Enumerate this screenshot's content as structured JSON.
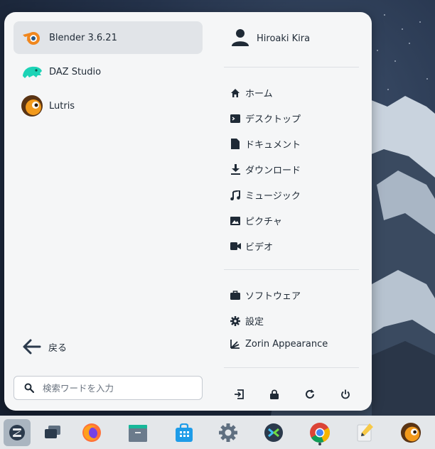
{
  "apps": [
    {
      "label": "Blender 3.6.21",
      "icon": "blender-icon",
      "selected": true
    },
    {
      "label": "DAZ Studio",
      "icon": "daz-studio-icon",
      "selected": false
    },
    {
      "label": "Lutris",
      "icon": "lutris-icon",
      "selected": false
    }
  ],
  "back_label": "戻る",
  "search": {
    "placeholder": "検索ワードを入力"
  },
  "user": {
    "name": "Hiroaki Kira"
  },
  "places": [
    {
      "label": "ホーム",
      "icon": "home-icon"
    },
    {
      "label": "デスクトップ",
      "icon": "desktop-icon"
    },
    {
      "label": "ドキュメント",
      "icon": "document-icon"
    },
    {
      "label": "ダウンロード",
      "icon": "download-icon"
    },
    {
      "label": "ミュージック",
      "icon": "music-icon"
    },
    {
      "label": "ピクチャ",
      "icon": "pictures-icon"
    },
    {
      "label": "ビデオ",
      "icon": "video-icon"
    }
  ],
  "system": [
    {
      "label": "ソフトウェア",
      "icon": "software-icon"
    },
    {
      "label": "設定",
      "icon": "settings-icon"
    },
    {
      "label": "Zorin Appearance",
      "icon": "zorin-appearance-icon"
    }
  ],
  "session_actions": [
    "log-out-icon",
    "lock-icon",
    "restart-icon",
    "power-icon"
  ],
  "taskbar": [
    "zorin-menu-icon",
    "workspaces-icon",
    "firefox-icon",
    "files-icon",
    "software-store-icon",
    "settings-icon",
    "remote-desktop-icon",
    "chrome-icon",
    "text-editor-icon",
    "lutris-icon"
  ],
  "colors": {
    "accent": "#2b3a4c",
    "selected_bg": "#e1e4e8",
    "panel_bg": "#f5f6f7",
    "taskbar_bg": "#e4e7ea"
  }
}
